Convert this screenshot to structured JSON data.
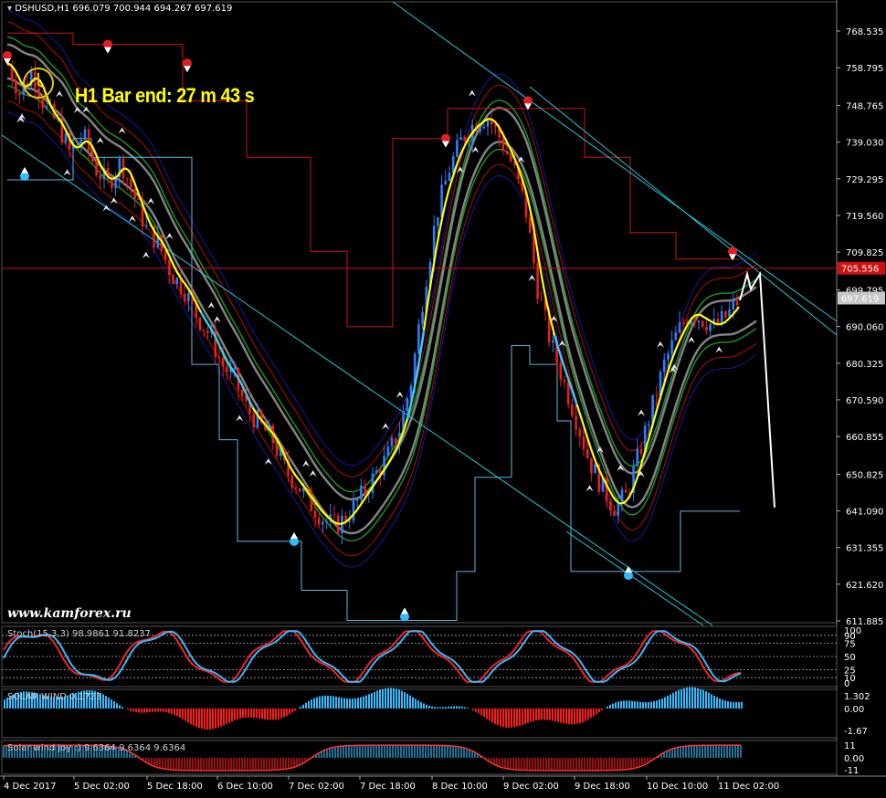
{
  "header": {
    "symbol_line": "DSHUSD,H1  696.079 700.944 694.267 697.619"
  },
  "timer_text": "H1 Bar end: 27 m 43 s",
  "watermark": "www.kamforex.ru",
  "colors": {
    "bull": "#2a7fff",
    "bear": "#e8201c",
    "ma_yellow": "#ffff00",
    "ma_cyan": "#33ccff",
    "channel_cyan": "#5bb8e0",
    "trend_line": "#22c8d8",
    "price_line": "#d01010",
    "stoch_red": "#ff2020",
    "stoch_blue": "#33bbff",
    "hist_pos": "#33bbff",
    "hist_neg": "#ff1a1a"
  },
  "price_tags": {
    "hline": "705.556",
    "current": "697.619"
  },
  "subwindows": {
    "stoch": {
      "label": "Stoch(15,3,3) 98.9861 91.8237",
      "levels": [
        "100",
        "90",
        "75",
        "50",
        "25",
        "10",
        "0"
      ]
    },
    "solar": {
      "label": "SOLAR WIND 0.1723",
      "levels": [
        "1.302",
        "0.00",
        "-1.67"
      ]
    },
    "joy": {
      "label": "Solar wind joy :) 9.6364 9.6364 9.6364",
      "levels": [
        "11",
        "0.00",
        "-11"
      ]
    }
  },
  "chart_data": {
    "type": "candlestick",
    "title": "DSHUSD,H1",
    "timeframe": "H1",
    "last_bar": {
      "open": 696.079,
      "high": 700.944,
      "low": 694.267,
      "close": 697.619
    },
    "y_ticks": [
      "768.535",
      "758.795",
      "748.765",
      "739.030",
      "729.295",
      "719.560",
      "709.825",
      "699.795",
      "690.060",
      "680.325",
      "670.590",
      "660.855",
      "650.825",
      "641.090",
      "631.355",
      "621.620",
      "611.885"
    ],
    "ylim": [
      611.885,
      768.535
    ],
    "x_ticks": [
      "4 Dec 2017",
      "5 Dec 02:00",
      "5 Dec 18:00",
      "6 Dec 10:00",
      "7 Dec 02:00",
      "7 Dec 18:00",
      "8 Dec 10:00",
      "9 Dec 02:00",
      "9 Dec 18:00",
      "10 Dec 10:00",
      "11 Dec 02:00"
    ],
    "horizontal_line": 705.556,
    "current_price": 697.619,
    "close_path": [
      760,
      752,
      758,
      748,
      744,
      736,
      741,
      732,
      728,
      734,
      725,
      716,
      712,
      704,
      700,
      693,
      688,
      680,
      676,
      668,
      664,
      660,
      652,
      648,
      643,
      639,
      637,
      640,
      645,
      650,
      655,
      662,
      676,
      700,
      720,
      732,
      740,
      744,
      746,
      740,
      733,
      722,
      700,
      686,
      676,
      666,
      655,
      648,
      642,
      645,
      656,
      668,
      680,
      688,
      694,
      692,
      690,
      693,
      697.6
    ]
  }
}
